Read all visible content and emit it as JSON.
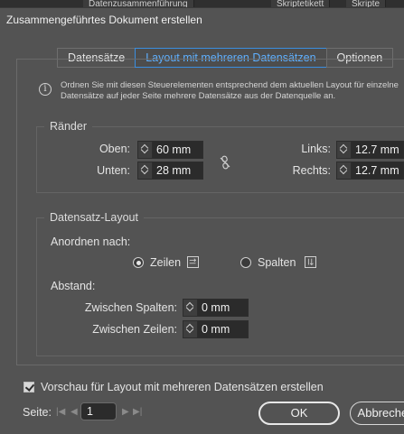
{
  "background_tabs": [
    "Datenzusammenführung",
    "Skriptetikett",
    "Skripte"
  ],
  "dialog": {
    "title": "Zusammengeführtes Dokument erstellen"
  },
  "tabs": [
    {
      "label": "Datensätze",
      "active": false
    },
    {
      "label": "Layout mit mehreren Datensätzen",
      "active": true
    },
    {
      "label": "Optionen",
      "active": false
    }
  ],
  "info": {
    "icon": "info-icon",
    "text": "Ordnen Sie mit diesen Steuerelementen entsprechend dem aktuellen Layout für einzelne Datensätze auf jeder Seite mehrere Datensätze aus der Datenquelle an."
  },
  "margins": {
    "title": "Ränder",
    "top_label": "Oben:",
    "top_value": "60 mm",
    "bottom_label": "Unten:",
    "bottom_value": "28 mm",
    "left_label": "Links:",
    "left_value": "12.7 mm",
    "right_label": "Rechts:",
    "right_value": "12.7 mm",
    "link_icon": "chain-broken-icon"
  },
  "record_layout": {
    "title": "Datensatz-Layout",
    "arrange_label": "Anordnen nach:",
    "rows_label": "Zeilen",
    "columns_label": "Spalten",
    "selected": "rows",
    "spacing_label": "Abstand:",
    "between_columns_label": "Zwischen Spalten:",
    "between_columns_value": "0 mm",
    "between_rows_label": "Zwischen Zeilen:",
    "between_rows_value": "0 mm"
  },
  "preview": {
    "label": "Vorschau für Layout mit mehreren Datensätzen erstellen",
    "checked": true
  },
  "pager": {
    "label": "Seite:",
    "value": "1"
  },
  "buttons": {
    "ok": "OK",
    "cancel": "Abbrechen"
  },
  "colors": {
    "accent": "#3b8ee0",
    "background": "#535353"
  }
}
